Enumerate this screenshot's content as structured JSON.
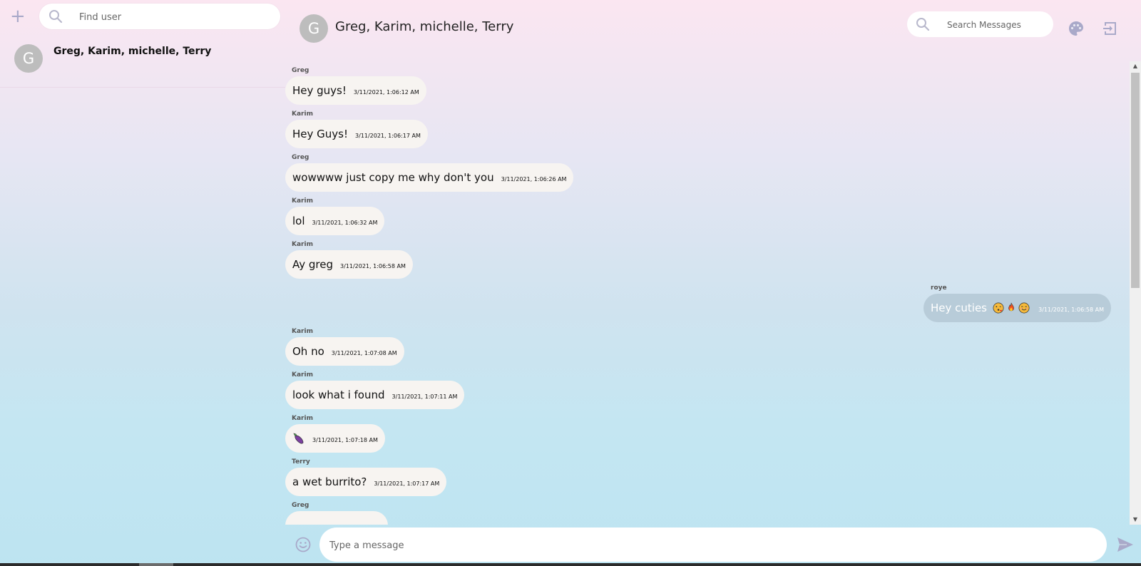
{
  "sidebar": {
    "add_icon": "plus-icon",
    "search": {
      "placeholder": "Find user",
      "icon": "search-icon"
    },
    "conversations": [
      {
        "avatar_letter": "G",
        "name": "Greg, Karim, michelle, Terry"
      }
    ]
  },
  "header": {
    "avatar_letter": "G",
    "title": "Greg, Karim, michelle, Terry",
    "search": {
      "placeholder": "Search Messages",
      "icon": "search-icon"
    },
    "theme_icon": "palette-icon",
    "logout_icon": "logout-icon"
  },
  "messages": [
    {
      "sender": "Greg",
      "text": "Hey guys!",
      "time": "3/11/2021, 1:06:12 AM"
    },
    {
      "sender": "Karim",
      "text": "Hey Guys!",
      "time": "3/11/2021, 1:06:17 AM"
    },
    {
      "sender": "Greg",
      "text": "wowwww just copy me why don't you",
      "time": "3/11/2021, 1:06:26 AM"
    },
    {
      "sender": "Karim",
      "text": "lol",
      "time": "3/11/2021, 1:06:32 AM"
    },
    {
      "sender": "Karim",
      "text": "Ay greg",
      "time": "3/11/2021, 1:06:58 AM"
    },
    {
      "sender": "roye",
      "text": "Hey cuties",
      "emojis": [
        "kiss-face",
        "fire",
        "smiling-face"
      ],
      "time": "3/11/2021, 1:06:58 AM",
      "mine": true
    },
    {
      "sender": "Karim",
      "text": "Oh no",
      "time": "3/11/2021, 1:07:08 AM"
    },
    {
      "sender": "Karim",
      "text": "look what i found",
      "time": "3/11/2021, 1:07:11 AM"
    },
    {
      "sender": "Karim",
      "text": "",
      "emojis": [
        "eggplant"
      ],
      "time": "3/11/2021, 1:07:18 AM"
    },
    {
      "sender": "Terry",
      "text": "a wet burrito?",
      "time": "3/11/2021, 1:07:17 AM"
    },
    {
      "sender": "Greg",
      "text": "",
      "time": ""
    }
  ],
  "composer": {
    "placeholder": "Type a message",
    "emoji_icon": "smiley-icon",
    "send_icon": "send-icon"
  },
  "colors": {
    "accent_icon": "#a9a9c9",
    "bubble_other": "#f7f4f1",
    "bubble_mine": "#b8ccd9",
    "avatar": "#bdbdbd"
  }
}
